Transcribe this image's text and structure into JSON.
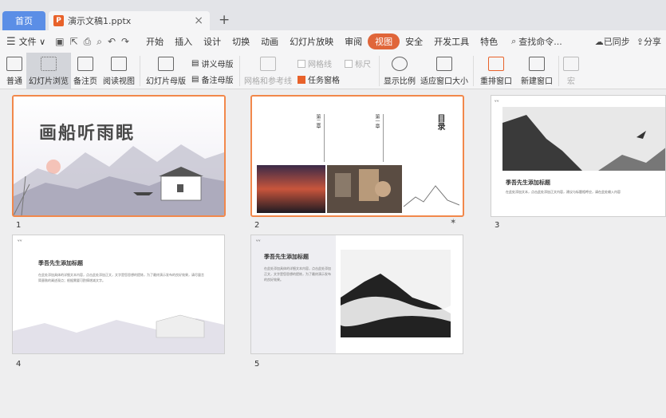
{
  "tabs": {
    "home": "首页",
    "document": "演示文稿1.pptx",
    "close_symbol": "×",
    "new_tab_symbol": "+"
  },
  "menubar": {
    "file": "文件",
    "items": [
      "开始",
      "插入",
      "设计",
      "切换",
      "动画",
      "幻灯片放映",
      "审阅",
      "视图",
      "安全",
      "开发工具",
      "特色"
    ],
    "active": "视图",
    "search": "查找命令...",
    "sync": "已同步",
    "share": "分享"
  },
  "ribbon": {
    "normal": "普通",
    "slide_sorter": "幻灯片浏览",
    "notes_page": "备注页",
    "reading_view": "阅读视图",
    "slide_master": "幻灯片母版",
    "handout_master": "讲义母版",
    "notes_master": "备注母版",
    "grid_guides": "网格和参考线",
    "gridlines": "网格线",
    "ruler": "标尺",
    "task_pane": "任务窗格",
    "zoom": "显示比例",
    "fit_window": "适应窗口大小",
    "arrange": "重排窗口",
    "new_window": "新建窗口",
    "macro": "宏"
  },
  "slides": [
    {
      "number": "1",
      "title": "画船听雨眠"
    },
    {
      "number": "2",
      "title": "目录",
      "section1": "第一章",
      "section2": "第二章"
    },
    {
      "number": "3",
      "title": "季吾先生添加标题",
      "body": "在此处添加文本，点击此处添加正文内容，建议与标题相呼应，请在此处输入内容"
    },
    {
      "number": "4",
      "title": "季吾先生添加标题",
      "body": "在此处添加具体的详细文本内容，点击此处添加正文，文字是您思想的提炼，为了最终演示发布的良好效果，请尽量言简意赅的阐述观点；根据需要可酌情增减文字。"
    },
    {
      "number": "5",
      "title": "季吾先生添加标题",
      "body": "在此处添加具体的详细文本内容，点击此处添加正文，文字是您思想的提炼，为了最终演示发布的良好效果。"
    }
  ]
}
